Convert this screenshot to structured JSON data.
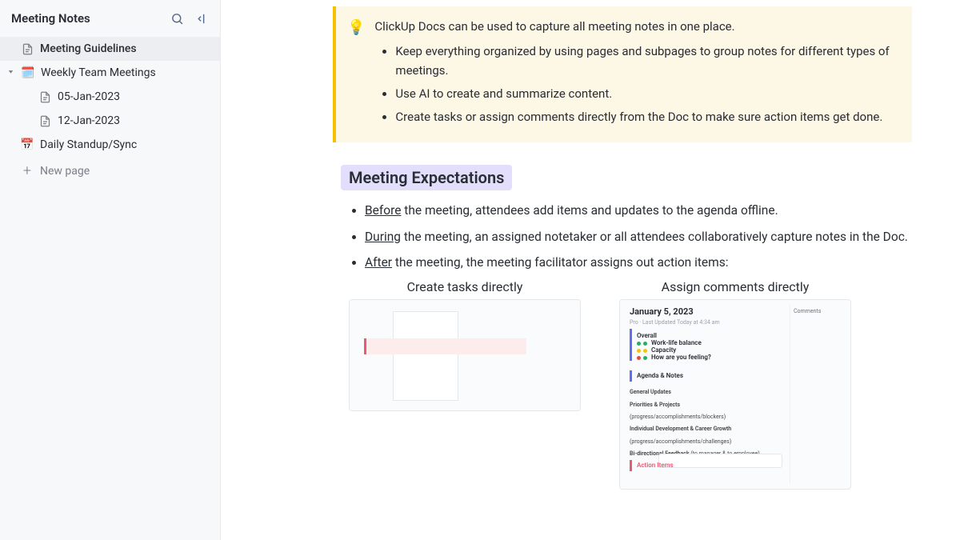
{
  "sidebar": {
    "title": "Meeting Notes",
    "items": [
      {
        "label": "Meeting Guidelines"
      },
      {
        "label": "Weekly Team Meetings"
      },
      {
        "label": "05-Jan-2023"
      },
      {
        "label": "12-Jan-2023"
      },
      {
        "label": "Daily Standup/Sync"
      }
    ],
    "new_page": "New page"
  },
  "callout": {
    "intro": "ClickUp Docs can be used to capture all meeting notes in one place.",
    "bullets": [
      "Keep everything organized by using pages and subpages to group notes for different types of meetings.",
      "Use AI to create and summarize content.",
      "Create tasks or assign comments directly from the Doc to make sure action items get done."
    ]
  },
  "section": {
    "heading": "Meeting Expectations",
    "items": [
      {
        "lead": "Before",
        "rest": " the meeting, attendees add items and updates to the agenda offline."
      },
      {
        "lead": "During",
        "rest": " the meeting, an assigned notetaker or all attendees collaboratively capture notes in the Doc."
      },
      {
        "lead": "After",
        "rest": " the meeting, the meeting facilitator assigns out action items:"
      }
    ]
  },
  "examples": {
    "left": "Create tasks directly",
    "right": "Assign comments directly",
    "img2": {
      "date": "January 5, 2023",
      "overall": "Overall",
      "agenda": "Agenda & Notes",
      "action": "Action Items",
      "comments_label": "Comments"
    }
  }
}
